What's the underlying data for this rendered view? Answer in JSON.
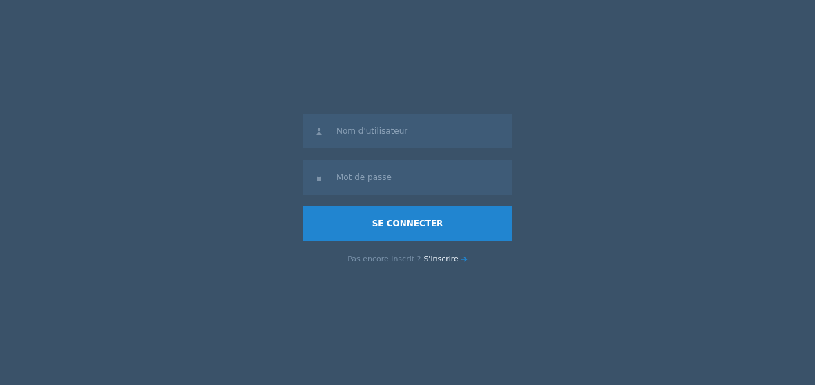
{
  "login_form": {
    "username": {
      "placeholder": "Nom d'utilisateur"
    },
    "password": {
      "placeholder": "Mot de passe"
    },
    "submit": {
      "label": "SE CONNECTER"
    },
    "signup": {
      "prompt": "Pas encore inscrit ?",
      "link": "S'inscrire"
    }
  }
}
